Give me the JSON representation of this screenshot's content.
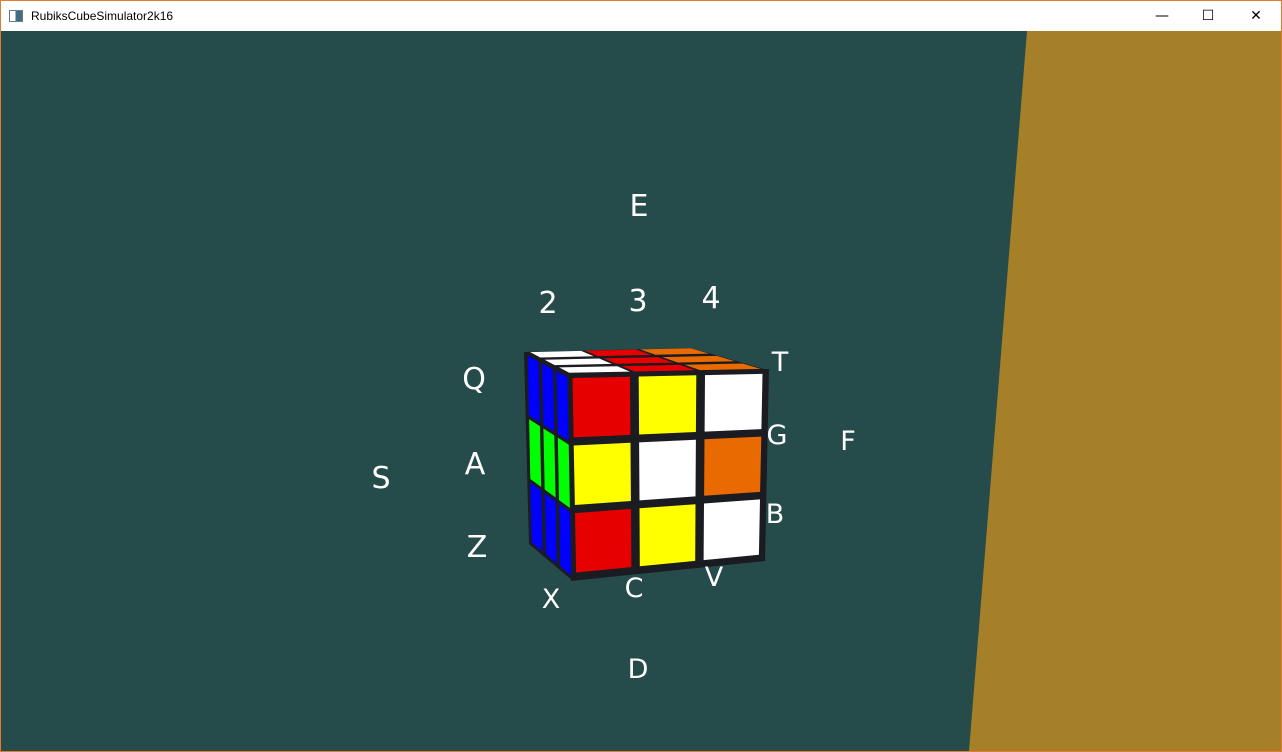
{
  "window": {
    "title": "RubiksCubeSimulator2k16",
    "controls": {
      "minimize": "—",
      "maximize": "☐",
      "close": "✕"
    }
  },
  "colors": {
    "background": "#254b4a",
    "floor": "#a67f29",
    "cube_body": "#1b1b22",
    "white": "#ffffff",
    "red": "#e60000",
    "yellow": "#ffff00",
    "orange": "#e86a00",
    "blue": "#0000ff",
    "green": "#00ff00",
    "label": "#ffffff"
  },
  "cube": {
    "front_face": [
      [
        "red",
        "yellow",
        "white"
      ],
      [
        "yellow",
        "white",
        "orange"
      ],
      [
        "red",
        "yellow",
        "white"
      ]
    ],
    "left_face": [
      [
        "blue",
        "blue",
        "blue"
      ],
      [
        "green",
        "green",
        "green"
      ],
      [
        "blue",
        "blue",
        "blue"
      ]
    ],
    "top_face": [
      [
        "white",
        "red",
        "orange"
      ],
      [
        "white",
        "red",
        "orange"
      ],
      [
        "white",
        "red",
        "orange"
      ]
    ]
  },
  "key_labels": {
    "top": "E",
    "bottom": "D",
    "left": "S",
    "right": "F",
    "col_1": "2",
    "col_2": "3",
    "col_3": "4",
    "row_top_left": "Q",
    "row_mid_left": "A",
    "row_bottom_left": "Z",
    "row_top_right": "T",
    "row_mid_right": "G",
    "row_bottom_right": "B",
    "bottom_col_1": "X",
    "bottom_col_2": "C",
    "bottom_col_3": "V"
  }
}
